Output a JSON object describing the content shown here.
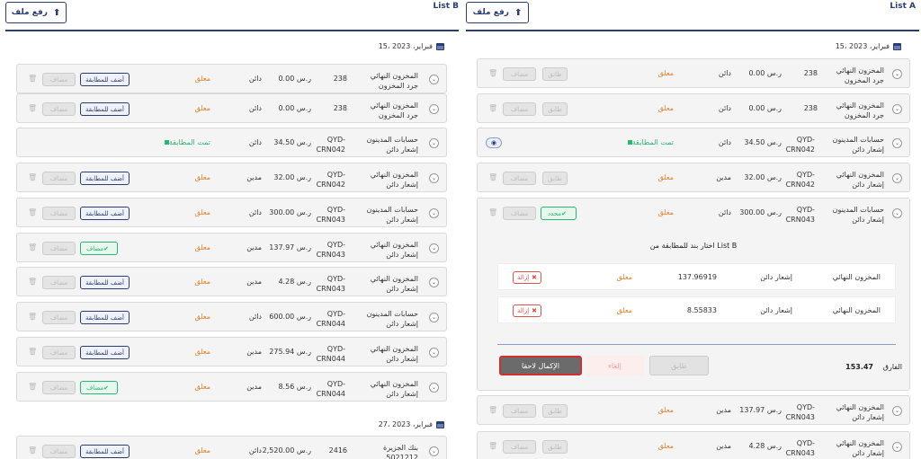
{
  "list_b": {
    "title": "List B",
    "upload_label": "رفع ملف",
    "date1": "15، فبراير، 2023",
    "date2": "27، فبراير، 2023",
    "rows": [
      {
        "l1": "المخزون النهائي",
        "l2": "جرد المخزون",
        "ref": "238",
        "amount": "0.00 ر.س",
        "type": "دائن",
        "status": "معلق",
        "action": "أضف للمطابقة"
      },
      {
        "l1": "المخزون النهائي",
        "l2": "جرد المخزون",
        "ref": "238",
        "amount": "0.00 ر.س",
        "type": "دائن",
        "status": "معلق",
        "action": "أضف للمطابقة"
      },
      {
        "l1": "حسابات المدينون",
        "l2": "إشعار دائن",
        "ref1": "QYD-",
        "ref2": "CRN042",
        "amount": "34.50 ر.س",
        "type": "دائن",
        "status": "تمت المطابقة"
      },
      {
        "l1": "المخزون النهائي",
        "l2": "إشعار دائن",
        "ref1": "QYD-",
        "ref2": "CRN042",
        "amount": "32.00 ر.س",
        "type": "مدين",
        "status": "معلق",
        "action": "أضف للمطابقة"
      },
      {
        "l1": "حسابات المدينون",
        "l2": "إشعار دائن",
        "ref1": "QYD-",
        "ref2": "CRN043",
        "amount": "300.00 ر.س",
        "type": "دائن",
        "status": "معلق",
        "action": "أضف للمطابقة"
      },
      {
        "l1": "المخزون النهائي",
        "l2": "إشعار دائن",
        "ref1": "QYD-",
        "ref2": "CRN043",
        "amount": "137.97 ر.س",
        "type": "مدين",
        "status": "معلق",
        "action": "مضاف"
      },
      {
        "l1": "المخزون النهائي",
        "l2": "إشعار دائن",
        "ref1": "QYD-",
        "ref2": "CRN043",
        "amount": "4.28 ر.س",
        "type": "مدين",
        "status": "معلق",
        "action": "أضف للمطابقة"
      },
      {
        "l1": "حسابات المدينون",
        "l2": "إشعار دائن",
        "ref1": "QYD-",
        "ref2": "CRN044",
        "amount": "600.00 ر.س",
        "type": "دائن",
        "status": "معلق",
        "action": "أضف للمطابقة"
      },
      {
        "l1": "المخزون النهائي",
        "l2": "إشعار دائن",
        "ref1": "QYD-",
        "ref2": "CRN044",
        "amount": "275.94 ر.س",
        "type": "مدين",
        "status": "معلق",
        "action": "أضف للمطابقة"
      },
      {
        "l1": "المخزون النهائي",
        "l2": "إشعار دائن",
        "ref1": "QYD-",
        "ref2": "CRN044",
        "amount": "8.56 ر.س",
        "type": "مدين",
        "status": "معلق",
        "action": "مضاف"
      },
      {
        "l1": "بنك الجزيرة",
        "l2": "5021212",
        "ref": "2416",
        "amount": "2,520.00 ر.س",
        "type": "دائن",
        "status": "معلق",
        "action": "أضف للمطابقة"
      }
    ],
    "add_label": "أضف للمطابقة",
    "added_label": "مضاف",
    "dis_label": "مضاف"
  },
  "list_a": {
    "title": "List A",
    "upload_label": "رفع ملف",
    "date1": "15، فبراير، 2023",
    "rows": [
      {
        "l1": "المخزون النهائي",
        "l2": "جرد المخزون",
        "ref": "238",
        "amount": "0.00 ر.س",
        "type": "دائن",
        "status": "معلق"
      },
      {
        "l1": "المخزون النهائي",
        "l2": "جرد المخزون",
        "ref": "238",
        "amount": "0.00 ر.س",
        "type": "دائن",
        "status": "معلق"
      },
      {
        "l1": "حسابات المدينون",
        "l2": "إشعار دائن",
        "ref1": "QYD-",
        "ref2": "CRN042",
        "amount": "34.50 ر.س",
        "type": "دائن",
        "status": "تمت المطابقة"
      },
      {
        "l1": "المخزون النهائي",
        "l2": "إشعار دائن",
        "ref1": "QYD-",
        "ref2": "CRN042",
        "amount": "32.00 ر.س",
        "type": "مدين",
        "status": "معلق"
      },
      {
        "l1": "حسابات المدينون",
        "l2": "إشعار دائن",
        "ref1": "QYD-",
        "ref2": "CRN043",
        "amount": "300.00 ر.س",
        "type": "دائن",
        "status": "معلق",
        "selected": "محدد"
      },
      {
        "l1": "المخزون النهائي",
        "l2": "إشعار دائن",
        "ref1": "QYD-",
        "ref2": "CRN043",
        "amount": "137.97 ر.س",
        "type": "مدين",
        "status": "معلق"
      },
      {
        "l1": "المخزون النهائي",
        "l2": "إشعار دائن",
        "ref1": "QYD-",
        "ref2": "CRN043",
        "amount": "4.28 ر.س",
        "type": "مدين",
        "status": "معلق"
      }
    ],
    "dis_label": "طابق",
    "dis_label2": "مضاف",
    "expanded": {
      "heading": "اختار بند للمطابقة من List B",
      "items": [
        {
          "account": "المخزون النهائي",
          "desc": "إشعار دائن",
          "value": "137.96919",
          "status": "معلق",
          "remove": "إزالة"
        },
        {
          "account": "المخزون النهائي",
          "desc": "إشعار دائن",
          "value": "8.55833",
          "status": "معلق",
          "remove": "إزالة"
        }
      ],
      "diff_label": "الفارق",
      "diff_value": "153.47",
      "match_btn": "طابق",
      "cancel_btn": "إلغاء",
      "later_btn": "الإكمال لاحقا"
    }
  }
}
